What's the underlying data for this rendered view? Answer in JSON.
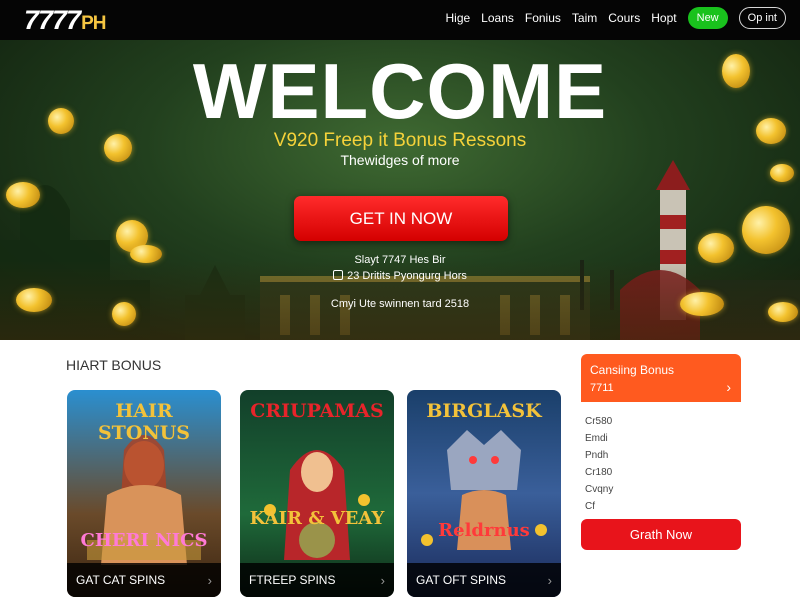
{
  "header": {
    "logo_main": "7777",
    "logo_suffix": "PH",
    "nav": [
      "Hige",
      "Loans",
      "Fonius",
      "Taim",
      "Cours",
      "Hopt"
    ],
    "btn_new": "New",
    "btn_login": "Op int"
  },
  "hero": {
    "title": "WELCOME",
    "subtitle": "V920 Freep it Bonus Ressons",
    "tagline": "Thewidges of more",
    "cta": "GET IN NOW",
    "info1": "Slayt 7747 Hes Bir",
    "info2": "23 Dritits Pyongurg Hors",
    "info3": "Cmyi Ute swinnen tard 2518"
  },
  "section": {
    "title": "HIART BONUS",
    "cards": [
      {
        "title": "HAIR STONUS",
        "sub": "CHERI NICS",
        "label": "GAT CAT SPINS"
      },
      {
        "title": "CRIUPAMAS",
        "sub": "KAIR & VEAY",
        "label": "FTREEP SPINS"
      },
      {
        "title": "BIRGLASK",
        "sub": "Reldrnus",
        "label": "GAT OFT SPINS"
      }
    ]
  },
  "side": {
    "title": "Cansiing Bonus",
    "amount": "7711",
    "items": [
      "Cr580",
      "Emdi",
      "Pndh",
      "Cr180",
      "Cvqny",
      "Cf"
    ],
    "button": "Grath Now"
  },
  "colors": {
    "accent_red": "#e8141b",
    "accent_green": "#19c21d",
    "accent_orange": "#ff5a1f",
    "gold": "#f5d23a"
  },
  "icons": {
    "card_arrow": "chevron-right-icon",
    "side_arrow": "chevron-right-icon",
    "checkbox": "checkbox-icon"
  }
}
